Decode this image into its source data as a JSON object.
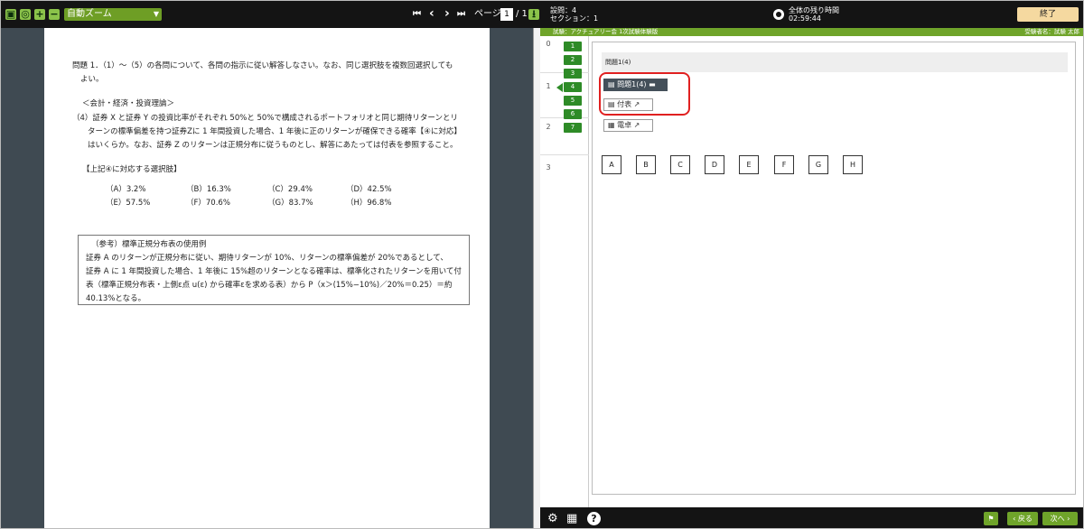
{
  "viewer": {
    "toolbar": {
      "sidebar_icon": "▣",
      "fit_icon": "◎",
      "zoom_in": "+",
      "zoom_out": "−",
      "zoom_select": "自動ズーム",
      "first_icon": "⏮",
      "prev_icon": "‹",
      "next_icon": "›",
      "last_icon": "⏭",
      "page_label": "ページ:",
      "page_value": "1",
      "page_total": "/ 1",
      "download_icon": "⭳"
    },
    "paper": {
      "intro_line1": "問題 1．（1）～（5）の各問について、各問の指示に従い解答しなさい。なお、同じ選択肢を複数回選択しても",
      "intro_line2": "よい。",
      "section_title": "＜会計・経済・投資理論＞",
      "q4_line1": "（4）証券 X と証券 Y の投資比率がそれぞれ 50%と 50%で構成されるポートフォリオと同じ期待リターンとリ",
      "q4_line2": "ターンの標準偏差を持つ証券Zに 1 年間投資した場合、1 年後に正のリターンが確保できる確率【④に対応】",
      "q4_line3": "はいくらか。なお、証券 Z のリターンは正規分布に従うものとし、解答にあたっては付表を参照すること。",
      "choices_title": "【上記④に対応する選択肢】",
      "choices": [
        "（A）3.2%",
        "（B）16.3%",
        "（C）29.4%",
        "（D）42.5%",
        "（E）57.5%",
        "（F）70.6%",
        "（G）83.7%",
        "（H）96.8%"
      ],
      "ref_title": "（参考）標準正規分布表の使用例",
      "ref_line1": "証券 A のリターンが正規分布に従い、期待リターンが 10%、リターンの標準偏差が 20%であるとして、",
      "ref_line2": "証券 A に 1 年間投資した場合、1 年後に 15%超のリターンとなる確率は、標準化されたリターンを用いて付",
      "ref_line3": "表（標準正規分布表・上側ε点 u(ε) から確率εを求める表）から P（x＞(15%−10%)／20%＝0.25）＝約",
      "ref_line4": "40.13%となる。"
    }
  },
  "exam": {
    "header": {
      "question_count": "設問：4",
      "section_count": "セクション：1",
      "timer_label": "全体の残り時間",
      "timer_value": "02:59:44",
      "finish_button": "終了"
    },
    "subbar": {
      "exam_name": "試験：アクチュアリー会 1次試験体験版",
      "examinee": "受験者名：試験 太郎"
    },
    "sections": [
      "0",
      "1",
      "2",
      "3"
    ],
    "questions": [
      "1",
      "2",
      "3",
      "4",
      "5",
      "6",
      "7"
    ],
    "question_title": "問題1(4)",
    "doc_question": "問題1(4)",
    "doc_table": "付表",
    "calculator": "電卓",
    "answer_choices": [
      "A",
      "B",
      "C",
      "D",
      "E",
      "F",
      "G",
      "H"
    ],
    "footer": {
      "back": "‹ 戻る",
      "next": "次へ ›"
    }
  },
  "colors": {
    "toolbar_bg": "#141414",
    "accent_green": "#6fa42a",
    "question_green": "#2e8b27",
    "viewer_bg": "#3f4a52",
    "highlight_red": "#e02020",
    "finish_bg": "#f5d9a0"
  }
}
